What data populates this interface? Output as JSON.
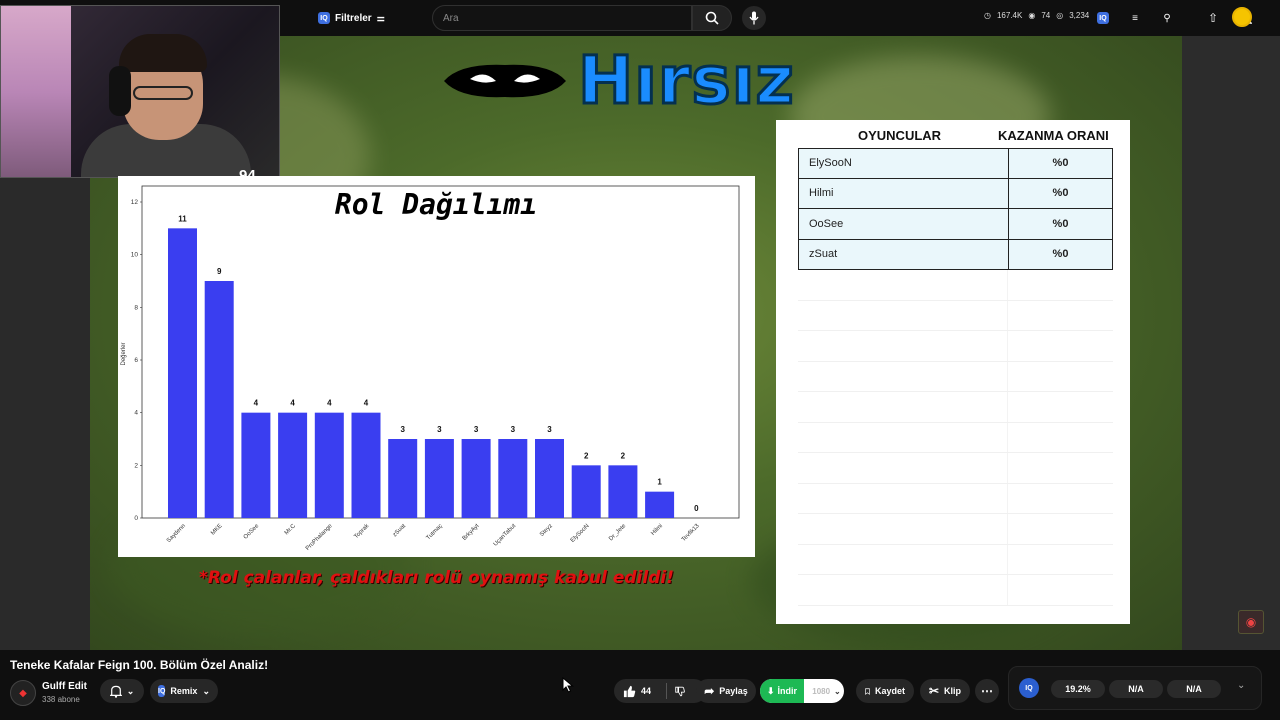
{
  "topbar": {
    "filter_label": "Filtreler",
    "iq_label": "IQ",
    "search_placeholder": "Ara",
    "stats": {
      "views": "167.4K",
      "likes": "74",
      "watching": "3,234"
    }
  },
  "webcam": {
    "level": "94"
  },
  "logo": {
    "text": "Hırsız"
  },
  "chart_data": {
    "type": "bar",
    "title": "Rol Dağılımı",
    "ylabel": "Değerler",
    "xlabel": "",
    "ylim": [
      0,
      12
    ],
    "yticks": [
      0,
      2,
      4,
      6,
      8,
      10,
      12
    ],
    "categories": [
      "Saydenn",
      "MKE",
      "OoSee",
      "Mr.C",
      "ProPhalange",
      "Toprak",
      "zSuat",
      "Tutmaç",
      "BrkyAyt",
      "UçanTabut",
      "Steyz",
      "ElySooN",
      "Dr_Jete",
      "Hilmi",
      "Tevfik13"
    ],
    "values": [
      11,
      9,
      4,
      4,
      4,
      4,
      3,
      3,
      3,
      3,
      3,
      2,
      2,
      1,
      0
    ],
    "color": "#3a3ef0"
  },
  "footnote": "*Rol çalanlar, çaldıkları rolü oynamış kabul edildi!",
  "table": {
    "headers": [
      "OYUNCULAR",
      "KAZANMA ORANI"
    ],
    "rows": [
      {
        "player": "ElySooN",
        "rate": "%0"
      },
      {
        "player": "Hilmi",
        "rate": "%0"
      },
      {
        "player": "OoSee",
        "rate": "%0"
      },
      {
        "player": "zSuat",
        "rate": "%0"
      }
    ]
  },
  "video": {
    "title": "Teneke Kafalar Feign 100. Bölüm Özel Analiz!",
    "channel": "Gulff Edit",
    "subscribers": "338 abone",
    "remix_label": "Remix",
    "likes": "44",
    "share_label": "Paylaş",
    "download_label": "İndir",
    "download_quality": "1080",
    "save_label": "Kaydet",
    "clip_label": "Klip"
  },
  "iq_panel": {
    "label": "IQ",
    "stat1": "19.2%",
    "stat2": "N/A",
    "stat3": "N/A"
  }
}
